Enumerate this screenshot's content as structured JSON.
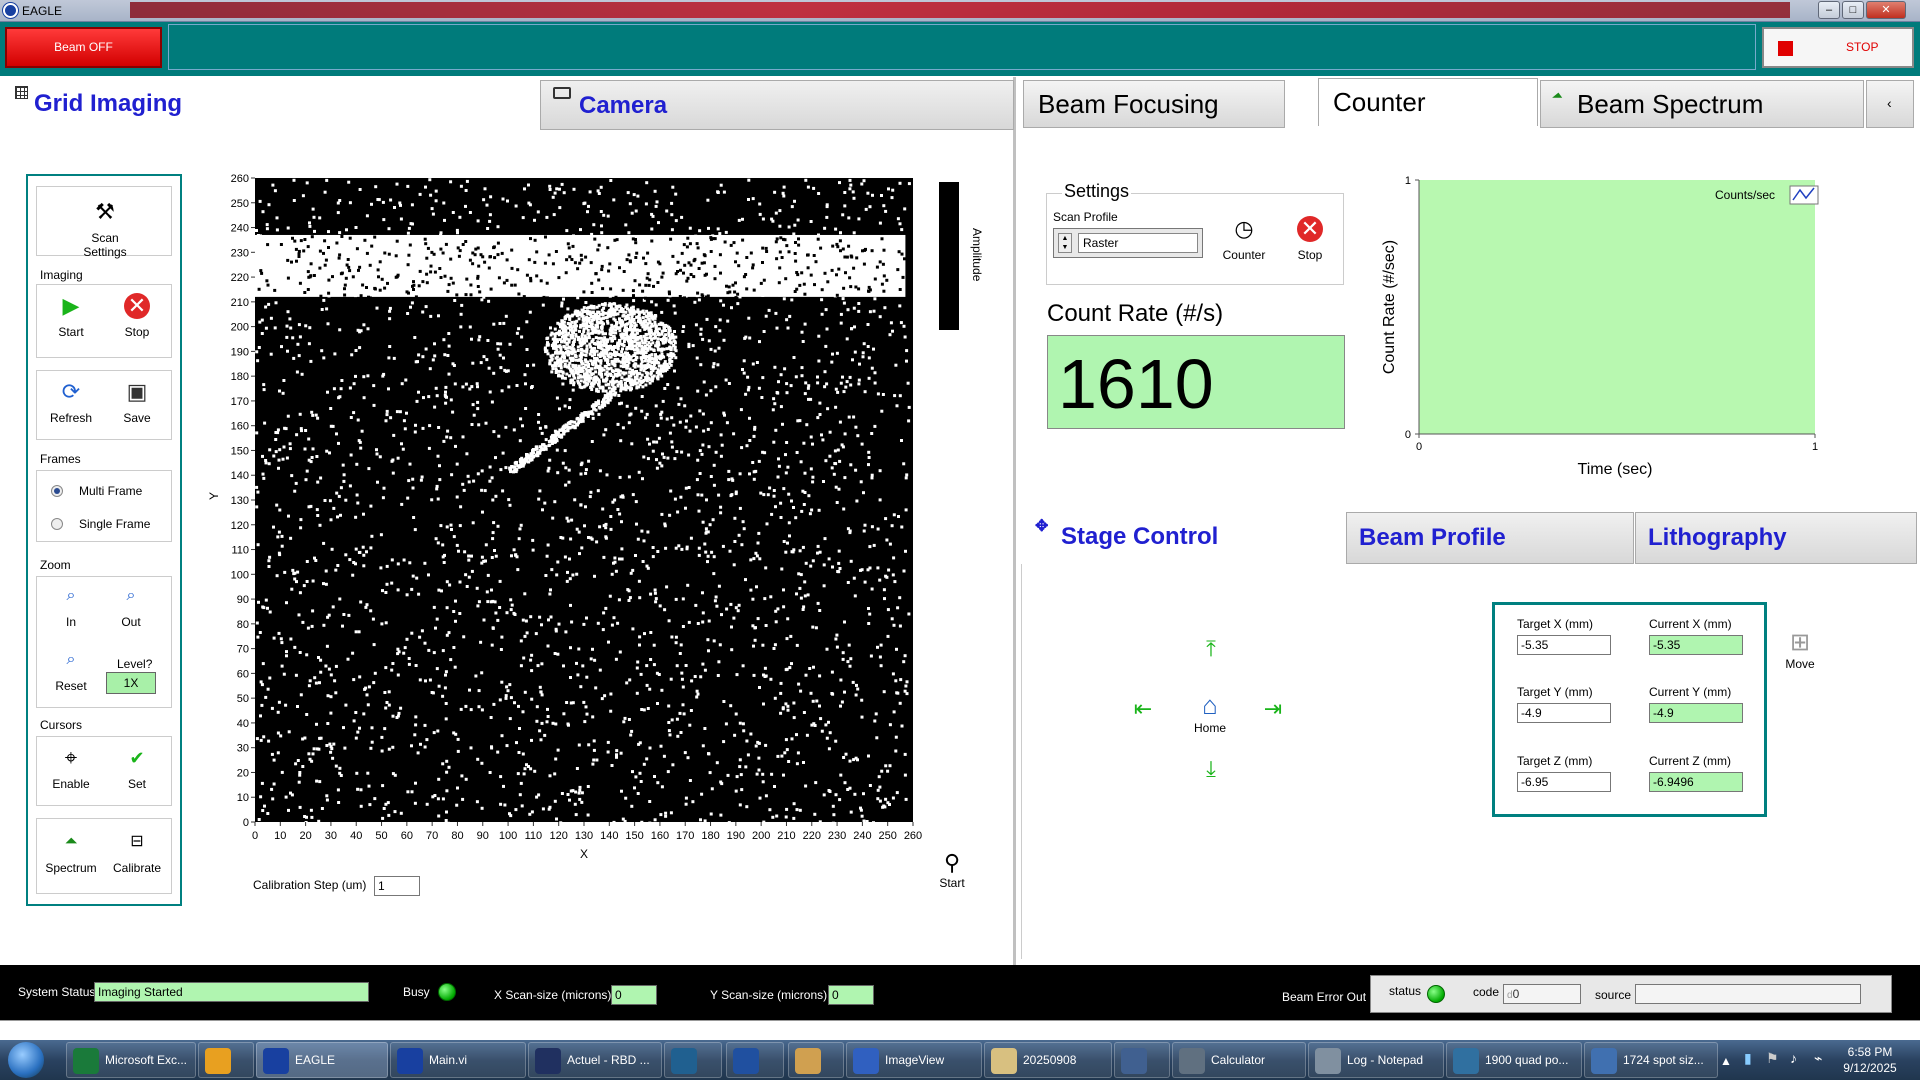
{
  "window": {
    "title": "EAGLE",
    "min": "–",
    "max": "□",
    "close": "✕"
  },
  "toolbar": {
    "beam_off": "Beam OFF",
    "stop": "STOP"
  },
  "left_tabs": {
    "grid": "Grid Imaging",
    "camera": "Camera"
  },
  "tools": {
    "scan_settings": "Scan Settings",
    "imaging_lbl": "Imaging",
    "start": "Start",
    "stop": "Stop",
    "refresh": "Refresh",
    "save": "Save",
    "frames_lbl": "Frames",
    "multi": "Multi Frame",
    "single": "Single Frame",
    "zoom_lbl": "Zoom",
    "in": "In",
    "out": "Out",
    "reset": "Reset",
    "level_q": "Level?",
    "level": "1X",
    "cursors_lbl": "Cursors",
    "enable": "Enable",
    "set": "Set",
    "spectrum": "Spectrum",
    "calibrate": "Calibrate"
  },
  "image_plot": {
    "xlabel": "X",
    "ylabel": "Y",
    "ticks": [
      0,
      10,
      20,
      30,
      40,
      50,
      60,
      70,
      80,
      90,
      100,
      110,
      120,
      130,
      140,
      150,
      160,
      170,
      180,
      190,
      200,
      210,
      220,
      230,
      240,
      250,
      260
    ],
    "colorbar_label": "Amplitude",
    "colorbar_max": "1",
    "colorbar_min": "0"
  },
  "calibration": {
    "label": "Calibration Step (um)",
    "value": "1",
    "start": "Start"
  },
  "right_tabs": {
    "focus": "Beam Focusing",
    "counter": "Counter",
    "spectrum": "Beam Spectrum",
    "scroll": "‹"
  },
  "counter": {
    "settings": "Settings",
    "scan_profile_lbl": "Scan Profile",
    "scan_profile": "Raster",
    "counter_btn": "Counter",
    "stop_btn": "Stop",
    "count_rate_lbl": "Count Rate (#/s)",
    "count_rate": "1610"
  },
  "chart_data": {
    "type": "line",
    "title": "",
    "xlabel": "Time (sec)",
    "ylabel": "Count Rate (#/sec)",
    "xlim": [
      0,
      1
    ],
    "ylim": [
      0,
      1
    ],
    "x_ticks": [
      "0",
      "1"
    ],
    "y_ticks": [
      "0",
      "1"
    ],
    "legend": "Counts/sec",
    "legend_position": "top-right",
    "series": [
      {
        "name": "Counts/sec",
        "values": []
      }
    ],
    "plot_bg": "#b8f8b0"
  },
  "stage_tabs": {
    "stage": "Stage Control",
    "beam_profile": "Beam Profile",
    "litho": "Lithography"
  },
  "stage": {
    "home": "Home",
    "move": "Move",
    "tx_lbl": "Target X (mm)",
    "tx": "-5.35",
    "cx_lbl": "Current X (mm)",
    "cx": "-5.35",
    "ty_lbl": "Target Y (mm)",
    "ty": "-4.9",
    "cy_lbl": "Current Y (mm)",
    "cy": "-4.9",
    "tz_lbl": "Target Z (mm)",
    "tz": "-6.95",
    "cz_lbl": "Current Z (mm)",
    "cz": "-6.9496"
  },
  "status": {
    "sys_lbl": "System Status",
    "sys": "Imaging Started",
    "busy_lbl": "Busy",
    "xscan_lbl": "X Scan-size (microns)",
    "xscan": "0",
    "yscan_lbl": "Y Scan-size (microns)",
    "yscan": "0",
    "beam_err_lbl": "Beam Error Out",
    "status_lbl": "status",
    "code_lbl": "code",
    "code": "0",
    "code_prefix": "d",
    "source_lbl": "source"
  },
  "taskbar": {
    "items": [
      "Microsoft Exc...",
      "",
      "EAGLE",
      "Main.vi",
      "Actuel - RBD ...",
      "",
      "",
      "",
      "ImageView",
      "20250908",
      "",
      "Calculator",
      "Log - Notepad",
      "1900 quad po...",
      "1724 spot siz..."
    ],
    "time": "6:58 PM",
    "date": "9/12/2025"
  },
  "colors": {
    "teal": "#007b7b",
    "accent_blue": "#2020d0",
    "green_field": "#b0f5b0",
    "beam_red": "#e00000"
  }
}
